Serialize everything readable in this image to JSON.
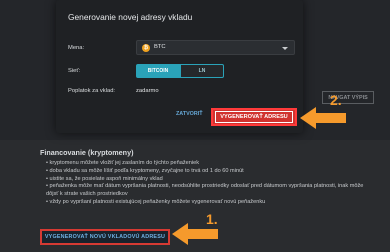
{
  "background": {
    "withdraw_button": "NAVGAT VÝPIS",
    "section_title": "Financovanie (kryptomeny)",
    "bullets": [
      "kryptomenu môžete vložiť jej zaslaním do týchto peňaženiek",
      "doba vkladu sa môže líšiť podľa kryptomeny, zvyčajne to trvá od 1 do 60 minút",
      "uistite sa, že posielate aspoň minimálny vklad",
      "peňaženka môže mať dátum vypršania platnosti, neodsúhlite prostriedky odoslať pred dátumom vypršania platnosti, inak môže dôjsť k strate vašich prostriedkov",
      "vždy po vypršaní platnosti existujúcej peňaženky môžete vygenerovať novú peňaženku"
    ],
    "new_address_button": "VYGENEROVAŤ NOVÚ VKLADOVÚ ADRESU"
  },
  "modal": {
    "title": "Generovanie novej adresy vkladu",
    "currency_label": "Mena:",
    "currency_value": "BTC",
    "network_label": "Sieť:",
    "network_options": [
      "BITCOIN",
      "LN"
    ],
    "fee_label": "Poplatok za vklad:",
    "fee_value": "zadarmo",
    "close_button": "ZATVORIŤ",
    "generate_button": "VYGENEROVAŤ ADRESU"
  },
  "annotations": {
    "step1": "1.",
    "step2": "2.",
    "arrow_color": "#f59a2c"
  }
}
